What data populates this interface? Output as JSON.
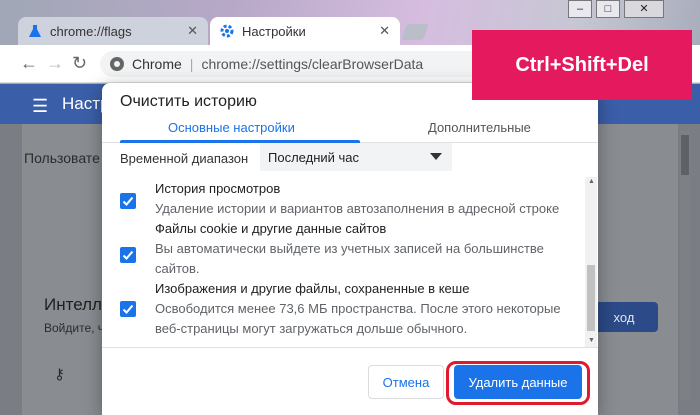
{
  "browser": {
    "tabs": [
      {
        "label": "chrome://flags"
      },
      {
        "label": "Настройки"
      }
    ],
    "omnibox": {
      "site": "Chrome",
      "url": "chrome://settings/clearBrowserData"
    }
  },
  "page": {
    "title": "Настр",
    "user_text": "Пользовате",
    "card_title": "Интелл",
    "card_sub": "Войдите, ч",
    "button_label": "ход"
  },
  "dialog": {
    "title": "Очистить историю",
    "tabs": {
      "basic": "Основные настройки",
      "advanced": "Дополнительные"
    },
    "range_label": "Временной диапазон",
    "range_value": "Последний час",
    "items": [
      {
        "title": "История просмотров",
        "desc": "Удаление истории и вариантов автозаполнения в адресной строке",
        "checked": true
      },
      {
        "title": "Файлы cookie и другие данные сайтов",
        "desc": "Вы автоматически выйдете из учетных записей на большинстве сайтов.",
        "checked": true
      },
      {
        "title": "Изображения и другие файлы, сохраненные в кеше",
        "desc": "Освободится менее 73,6 МБ пространства. После этого некоторые веб-страницы могут загружаться дольше обычного.",
        "checked": true
      }
    ],
    "cancel_label": "Отмена",
    "delete_label": "Удалить данные"
  },
  "overlay": {
    "shortcut": "Ctrl+Shift+Del"
  },
  "colors": {
    "accent": "#1a73e8",
    "highlight": "#e0192f",
    "badge": "#e5195e"
  }
}
